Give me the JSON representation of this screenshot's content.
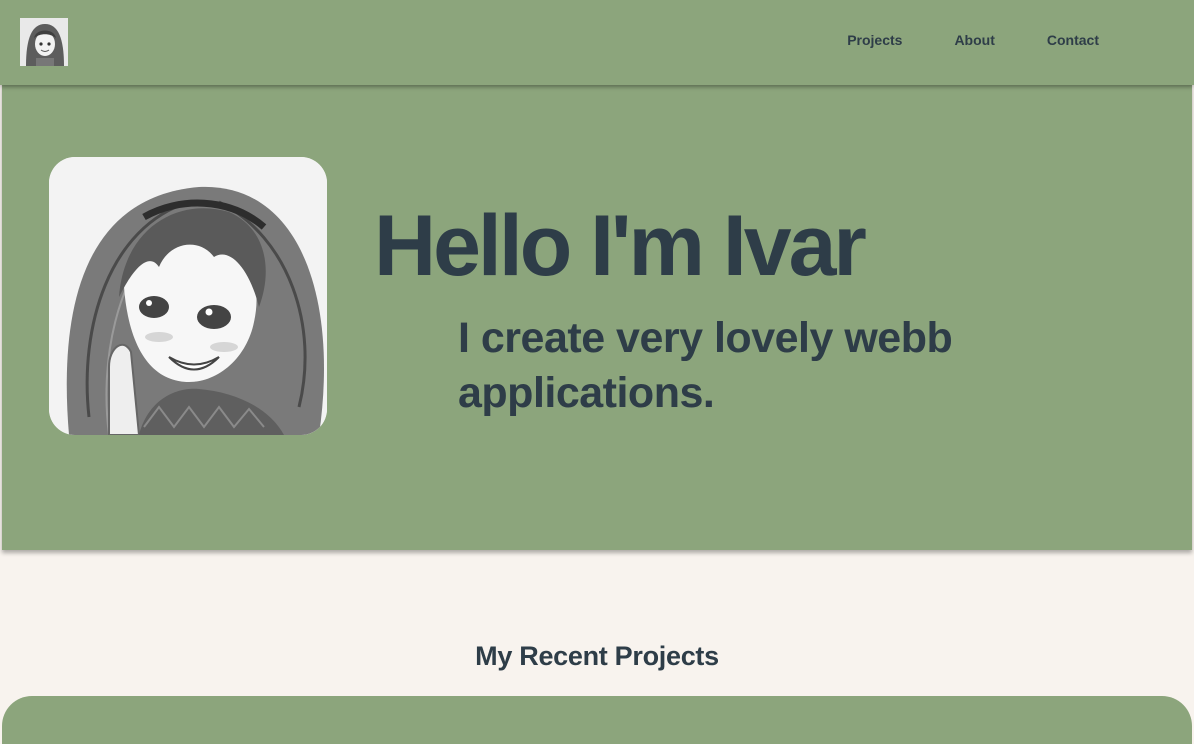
{
  "nav": {
    "logo_icon": "avatar-thumbnail-icon",
    "links": [
      {
        "label": "Projects"
      },
      {
        "label": "About"
      },
      {
        "label": "Contact"
      }
    ]
  },
  "hero": {
    "avatar_icon": "anime-girl-portrait-icon",
    "title": "Hello I'm Ivar",
    "subtitle": "I create very lovely webb applications."
  },
  "projects": {
    "section_title": "My Recent Projects"
  },
  "colors": {
    "brand_green": "#8ca57c",
    "text_dark": "#2e3d48",
    "background_cream": "#f8f3ee"
  }
}
